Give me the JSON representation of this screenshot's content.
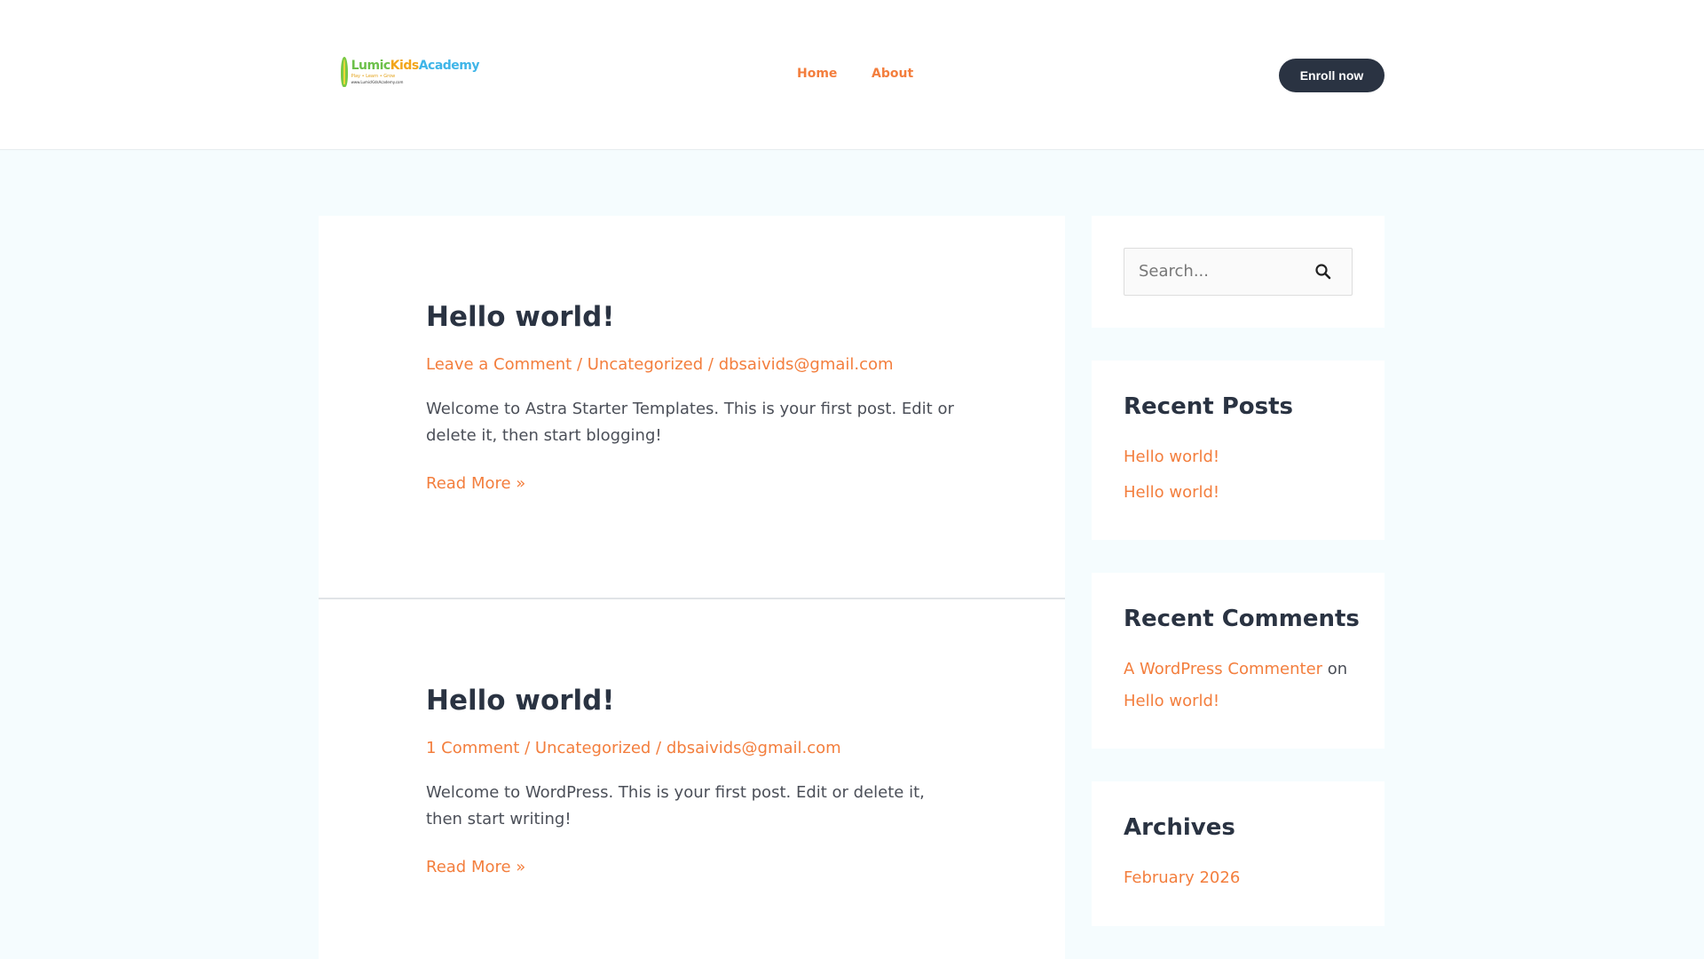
{
  "header": {
    "logo_text": "LumicKidsAcademy",
    "logo_tagline": "Play • Learn • Grow",
    "logo_url": "www.LumicKidsAcademy.com",
    "nav": [
      "Home",
      "About"
    ],
    "cta": "Enroll now"
  },
  "posts": [
    {
      "title": "Hello world!",
      "meta": [
        "Leave a Comment",
        "Uncategorized",
        "dbsaivids@gmail.com"
      ],
      "excerpt": "Welcome to Astra Starter Templates. This is your first post. Edit or delete it, then start blogging!",
      "read_more": "Read More »"
    },
    {
      "title": "Hello world!",
      "meta": [
        "1 Comment",
        "Uncategorized",
        "dbsaivids@gmail.com"
      ],
      "excerpt": "Welcome to WordPress. This is your first post. Edit or delete it, then start writing!",
      "read_more": "Read More »"
    }
  ],
  "sidebar": {
    "search_placeholder": "Search...",
    "recent_posts": {
      "title": "Recent Posts",
      "items": [
        "Hello world!",
        "Hello world!"
      ]
    },
    "recent_comments": {
      "title": "Recent Comments",
      "author": "A WordPress Commenter",
      "on": "on",
      "post": "Hello world!"
    },
    "archives": {
      "title": "Archives",
      "items": [
        "February 2026"
      ]
    }
  },
  "sep": " / "
}
